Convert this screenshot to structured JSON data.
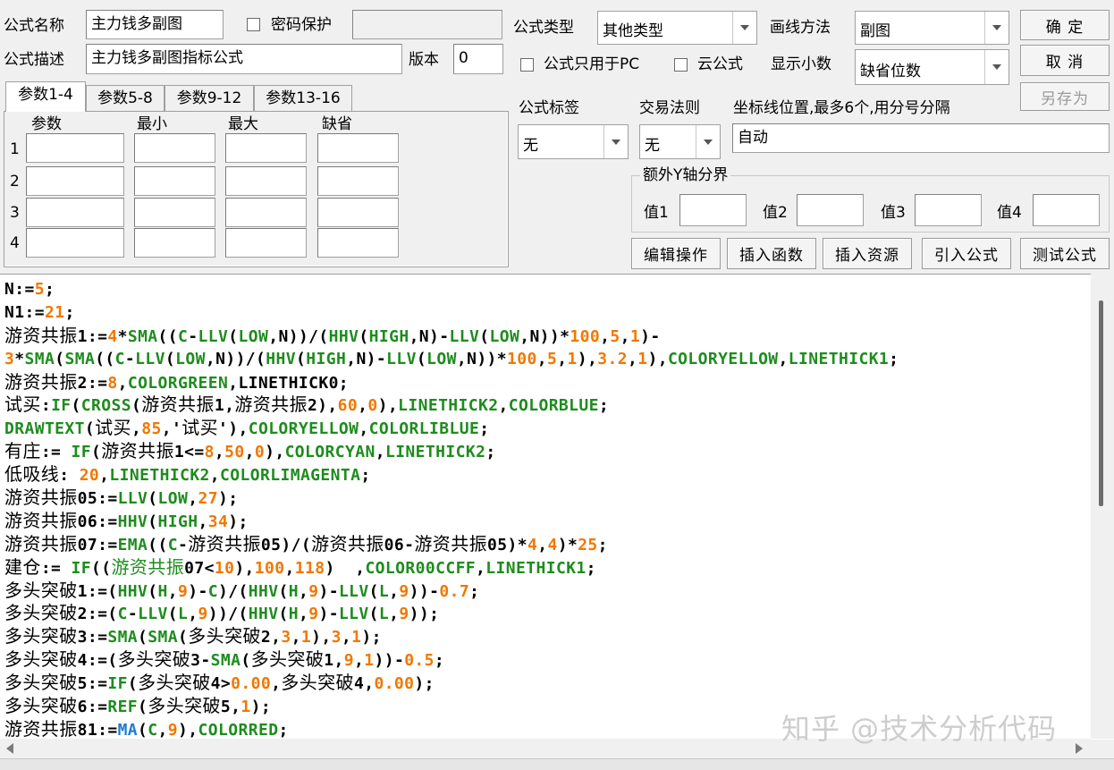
{
  "header": {
    "name_label": "公式名称",
    "name_value": "主力钱多副图",
    "password_label": "密码保护",
    "desc_label": "公式描述",
    "desc_value": "主力钱多副图指标公式",
    "version_label": "版本",
    "version_value": "0"
  },
  "formula_type": {
    "label": "公式类型",
    "value": "其他类型"
  },
  "draw_method": {
    "label": "画线方法",
    "value": "副图"
  },
  "pc_only_label": "公式只用于PC",
  "cloud_label": "云公式",
  "decimals": {
    "label": "显示小数",
    "value": "缺省位数"
  },
  "buttons": {
    "ok": "确  定",
    "cancel": "取  消",
    "save_as": "另存为"
  },
  "tabs": [
    "参数1-4",
    "参数5-8",
    "参数9-12",
    "参数13-16"
  ],
  "params": {
    "headers": [
      "参数",
      "最小",
      "最大",
      "缺省"
    ],
    "rows": [
      "1",
      "2",
      "3",
      "4"
    ]
  },
  "tag": {
    "label": "公式标签",
    "value": "无"
  },
  "trade_rule": {
    "label": "交易法则",
    "value": "无"
  },
  "coord": {
    "label": "坐标线位置,最多6个,用分号分隔",
    "value": "自动"
  },
  "y_axis": {
    "label": "额外Y轴分界",
    "v1": "值1",
    "v2": "值2",
    "v3": "值3",
    "v4": "值4"
  },
  "actions": [
    "编辑操作",
    "插入函数",
    "插入资源",
    "引入公式",
    "测试公式"
  ],
  "code_lines": [
    [
      [
        "k",
        "N:="
      ],
      [
        "n",
        "5"
      ],
      [
        "k",
        ";"
      ]
    ],
    [
      [
        "k",
        "N1:="
      ],
      [
        "n",
        "21"
      ],
      [
        "k",
        ";"
      ]
    ],
    [
      [
        "z",
        "游资共振"
      ],
      [
        "k",
        "1:="
      ],
      [
        "n",
        "4"
      ],
      [
        "k",
        "*"
      ],
      [
        "f",
        "SMA"
      ],
      [
        "k",
        "(("
      ],
      [
        "f",
        "C"
      ],
      [
        "k",
        "-"
      ],
      [
        "f",
        "LLV"
      ],
      [
        "k",
        "("
      ],
      [
        "f",
        "LOW"
      ],
      [
        "k",
        ",N))/("
      ],
      [
        "f",
        "HHV"
      ],
      [
        "k",
        "("
      ],
      [
        "f",
        "HIGH"
      ],
      [
        "k",
        ",N)-"
      ],
      [
        "f",
        "LLV"
      ],
      [
        "k",
        "("
      ],
      [
        "f",
        "LOW"
      ],
      [
        "k",
        ",N))*"
      ],
      [
        "n",
        "100"
      ],
      [
        "k",
        ","
      ],
      [
        "n",
        "5"
      ],
      [
        "k",
        ","
      ],
      [
        "n",
        "1"
      ],
      [
        "k",
        ")-"
      ]
    ],
    [
      [
        "n",
        "3"
      ],
      [
        "k",
        "*"
      ],
      [
        "f",
        "SMA"
      ],
      [
        "k",
        "("
      ],
      [
        "f",
        "SMA"
      ],
      [
        "k",
        "(("
      ],
      [
        "f",
        "C"
      ],
      [
        "k",
        "-"
      ],
      [
        "f",
        "LLV"
      ],
      [
        "k",
        "("
      ],
      [
        "f",
        "LOW"
      ],
      [
        "k",
        ",N))/("
      ],
      [
        "f",
        "HHV"
      ],
      [
        "k",
        "("
      ],
      [
        "f",
        "HIGH"
      ],
      [
        "k",
        ",N)-"
      ],
      [
        "f",
        "LLV"
      ],
      [
        "k",
        "("
      ],
      [
        "f",
        "LOW"
      ],
      [
        "k",
        ",N))*"
      ],
      [
        "n",
        "100"
      ],
      [
        "k",
        ","
      ],
      [
        "n",
        "5"
      ],
      [
        "k",
        ","
      ],
      [
        "n",
        "1"
      ],
      [
        "k",
        "),"
      ],
      [
        "n",
        "3.2"
      ],
      [
        "k",
        ","
      ],
      [
        "n",
        "1"
      ],
      [
        "k",
        "),"
      ],
      [
        "f",
        "COLORYELLOW"
      ],
      [
        "k",
        ","
      ],
      [
        "f",
        "LINETHICK1"
      ],
      [
        "k",
        ";"
      ]
    ],
    [
      [
        "z",
        "游资共振"
      ],
      [
        "k",
        "2:="
      ],
      [
        "n",
        "8"
      ],
      [
        "k",
        ","
      ],
      [
        "f",
        "COLORGREEN"
      ],
      [
        "k",
        ",LINETHICK0;"
      ]
    ],
    [
      [
        "z",
        "试买"
      ],
      [
        "k",
        ":"
      ],
      [
        "f",
        "IF"
      ],
      [
        "k",
        "("
      ],
      [
        "f",
        "CROSS"
      ],
      [
        "k",
        "("
      ],
      [
        "z",
        "游资共振"
      ],
      [
        "k",
        "1,"
      ],
      [
        "z",
        "游资共振"
      ],
      [
        "k",
        "2),"
      ],
      [
        "n",
        "60"
      ],
      [
        "k",
        ","
      ],
      [
        "n",
        "0"
      ],
      [
        "k",
        "),"
      ],
      [
        "f",
        "LINETHICK2"
      ],
      [
        "k",
        ","
      ],
      [
        "f",
        "COLORBLUE"
      ],
      [
        "k",
        ";"
      ]
    ],
    [
      [
        "f",
        "DRAWTEXT"
      ],
      [
        "k",
        "("
      ],
      [
        "z",
        "试买"
      ],
      [
        "k",
        ","
      ],
      [
        "n",
        "85"
      ],
      [
        "k",
        ",'"
      ],
      [
        "z",
        "试买"
      ],
      [
        "k",
        "'),"
      ],
      [
        "f",
        "COLORYELLOW"
      ],
      [
        "k",
        ","
      ],
      [
        "f",
        "COLORLIBLUE"
      ],
      [
        "k",
        ";"
      ]
    ],
    [
      [
        "z",
        "有庄"
      ],
      [
        "k",
        ":= "
      ],
      [
        "f",
        "IF"
      ],
      [
        "k",
        "("
      ],
      [
        "z",
        "游资共振"
      ],
      [
        "k",
        "1<="
      ],
      [
        "n",
        "8"
      ],
      [
        "k",
        ","
      ],
      [
        "n",
        "50"
      ],
      [
        "k",
        ","
      ],
      [
        "n",
        "0"
      ],
      [
        "k",
        "),"
      ],
      [
        "f",
        "COLORCYAN"
      ],
      [
        "k",
        ","
      ],
      [
        "f",
        "LINETHICK2"
      ],
      [
        "k",
        ";"
      ]
    ],
    [
      [
        "z",
        "低吸线"
      ],
      [
        "k",
        ": "
      ],
      [
        "n",
        "20"
      ],
      [
        "k",
        ","
      ],
      [
        "f",
        "LINETHICK2"
      ],
      [
        "k",
        ","
      ],
      [
        "f",
        "COLORLIMAGENTA"
      ],
      [
        "k",
        ";"
      ]
    ],
    [
      [
        "z",
        "游资共振"
      ],
      [
        "k",
        "05:="
      ],
      [
        "f",
        "LLV"
      ],
      [
        "k",
        "("
      ],
      [
        "f",
        "LOW"
      ],
      [
        "k",
        ","
      ],
      [
        "n",
        "27"
      ],
      [
        "k",
        ");"
      ]
    ],
    [
      [
        "z",
        "游资共振"
      ],
      [
        "k",
        "06:="
      ],
      [
        "f",
        "HHV"
      ],
      [
        "k",
        "("
      ],
      [
        "f",
        "HIGH"
      ],
      [
        "k",
        ","
      ],
      [
        "n",
        "34"
      ],
      [
        "k",
        ");"
      ]
    ],
    [
      [
        "z",
        "游资共振"
      ],
      [
        "k",
        "07:="
      ],
      [
        "f",
        "EMA"
      ],
      [
        "k",
        "(("
      ],
      [
        "f",
        "C"
      ],
      [
        "k",
        "-"
      ],
      [
        "z",
        "游资共振"
      ],
      [
        "k",
        "05)/("
      ],
      [
        "z",
        "游资共振"
      ],
      [
        "k",
        "06-"
      ],
      [
        "z",
        "游资共振"
      ],
      [
        "k",
        "05)*"
      ],
      [
        "n",
        "4"
      ],
      [
        "k",
        ","
      ],
      [
        "n",
        "4"
      ],
      [
        "k",
        ")*"
      ],
      [
        "n",
        "25"
      ],
      [
        "k",
        ";"
      ]
    ],
    [
      [
        "z",
        "建仓"
      ],
      [
        "k",
        ":= "
      ],
      [
        "f",
        "IF"
      ],
      [
        "k",
        "(("
      ],
      [
        "g",
        "游资共振"
      ],
      [
        "k",
        "07<"
      ],
      [
        "n",
        "10"
      ],
      [
        "k",
        "),"
      ],
      [
        "n",
        "100"
      ],
      [
        "k",
        ","
      ],
      [
        "n",
        "118"
      ],
      [
        "k",
        ")  ,"
      ],
      [
        "f",
        "COLOR00CCFF"
      ],
      [
        "k",
        ","
      ],
      [
        "f",
        "LINETHICK1"
      ],
      [
        "k",
        ";"
      ]
    ],
    [
      [
        "z",
        "多头突破"
      ],
      [
        "k",
        "1:=("
      ],
      [
        "f",
        "HHV"
      ],
      [
        "k",
        "("
      ],
      [
        "f",
        "H"
      ],
      [
        "k",
        ","
      ],
      [
        "n",
        "9"
      ],
      [
        "k",
        ")-"
      ],
      [
        "f",
        "C"
      ],
      [
        "k",
        ")/("
      ],
      [
        "f",
        "HHV"
      ],
      [
        "k",
        "("
      ],
      [
        "f",
        "H"
      ],
      [
        "k",
        ","
      ],
      [
        "n",
        "9"
      ],
      [
        "k",
        ")-"
      ],
      [
        "f",
        "LLV"
      ],
      [
        "k",
        "("
      ],
      [
        "f",
        "L"
      ],
      [
        "k",
        ","
      ],
      [
        "n",
        "9"
      ],
      [
        "k",
        "))-"
      ],
      [
        "n",
        "0.7"
      ],
      [
        "k",
        ";"
      ]
    ],
    [
      [
        "z",
        "多头突破"
      ],
      [
        "k",
        "2:=("
      ],
      [
        "f",
        "C"
      ],
      [
        "k",
        "-"
      ],
      [
        "f",
        "LLV"
      ],
      [
        "k",
        "("
      ],
      [
        "f",
        "L"
      ],
      [
        "k",
        ","
      ],
      [
        "n",
        "9"
      ],
      [
        "k",
        "))/("
      ],
      [
        "f",
        "HHV"
      ],
      [
        "k",
        "("
      ],
      [
        "f",
        "H"
      ],
      [
        "k",
        ","
      ],
      [
        "n",
        "9"
      ],
      [
        "k",
        ")-"
      ],
      [
        "f",
        "LLV"
      ],
      [
        "k",
        "("
      ],
      [
        "f",
        "L"
      ],
      [
        "k",
        ","
      ],
      [
        "n",
        "9"
      ],
      [
        "k",
        "));"
      ]
    ],
    [
      [
        "z",
        "多头突破"
      ],
      [
        "k",
        "3:="
      ],
      [
        "f",
        "SMA"
      ],
      [
        "k",
        "("
      ],
      [
        "f",
        "SMA"
      ],
      [
        "k",
        "("
      ],
      [
        "z",
        "多头突破"
      ],
      [
        "k",
        "2,"
      ],
      [
        "n",
        "3"
      ],
      [
        "k",
        ","
      ],
      [
        "n",
        "1"
      ],
      [
        "k",
        "),"
      ],
      [
        "n",
        "3"
      ],
      [
        "k",
        ","
      ],
      [
        "n",
        "1"
      ],
      [
        "k",
        ");"
      ]
    ],
    [
      [
        "z",
        "多头突破"
      ],
      [
        "k",
        "4:=("
      ],
      [
        "z",
        "多头突破"
      ],
      [
        "k",
        "3-"
      ],
      [
        "f",
        "SMA"
      ],
      [
        "k",
        "("
      ],
      [
        "z",
        "多头突破"
      ],
      [
        "k",
        "1,"
      ],
      [
        "n",
        "9"
      ],
      [
        "k",
        ","
      ],
      [
        "n",
        "1"
      ],
      [
        "k",
        "))-"
      ],
      [
        "n",
        "0.5"
      ],
      [
        "k",
        ";"
      ]
    ],
    [
      [
        "z",
        "多头突破"
      ],
      [
        "k",
        "5:="
      ],
      [
        "f",
        "IF"
      ],
      [
        "k",
        "("
      ],
      [
        "z",
        "多头突破"
      ],
      [
        "k",
        "4>"
      ],
      [
        "n",
        "0.00"
      ],
      [
        "k",
        ","
      ],
      [
        "z",
        "多头突破"
      ],
      [
        "k",
        "4,"
      ],
      [
        "n",
        "0.00"
      ],
      [
        "k",
        ");"
      ]
    ],
    [
      [
        "z",
        "多头突破"
      ],
      [
        "k",
        "6:="
      ],
      [
        "f",
        "REF"
      ],
      [
        "k",
        "("
      ],
      [
        "z",
        "多头突破"
      ],
      [
        "k",
        "5,"
      ],
      [
        "n",
        "1"
      ],
      [
        "k",
        ");"
      ]
    ],
    [
      [
        "z",
        "游资共振"
      ],
      [
        "k",
        "81:="
      ],
      [
        "b",
        "MA"
      ],
      [
        "k",
        "("
      ],
      [
        "f",
        "C"
      ],
      [
        "k",
        ","
      ],
      [
        "n",
        "9"
      ],
      [
        "k",
        "),"
      ],
      [
        "f",
        "COLORRED"
      ],
      [
        "k",
        ";"
      ]
    ]
  ],
  "colors": {
    "keyword": "#000000",
    "function": "#1e8c1e",
    "number": "#f07800",
    "func_blue": "#1c7cd0"
  },
  "watermark": "知乎 @技术分析代码"
}
